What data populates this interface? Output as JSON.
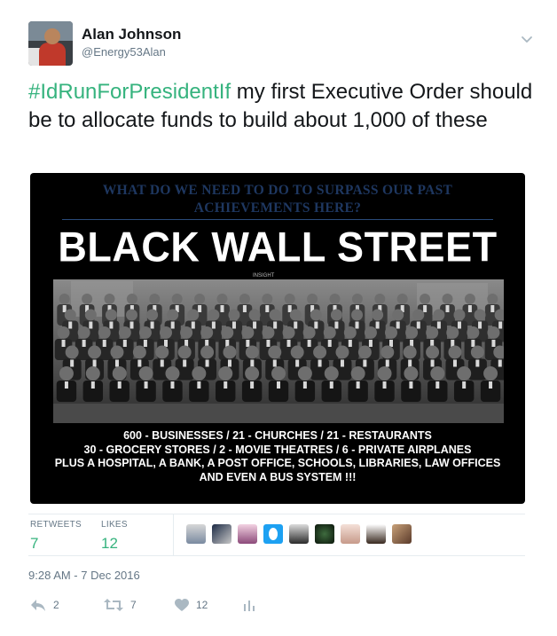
{
  "author": {
    "name": "Alan Johnson",
    "handle": "@Energy53Alan"
  },
  "tweet": {
    "hashtag": "#IdRunForPresidentIf",
    "text": " my first Executive Order should be to allocate funds to build about 1,000 of these"
  },
  "media": {
    "question_line1": "WHAT DO WE NEED TO DO TO SURPASS OUR PAST",
    "question_line2": "ACHIEVEMENTS HERE?",
    "headline": "BLACK WALL STREET",
    "fine_print": "INSIGHT",
    "facts_line1": "600 - BUSINESSES / 21 - CHURCHES / 21 - RESTAURANTS",
    "facts_line2": "30 - GROCERY STORES / 2 - MOVIE THEATRES / 6 - PRIVATE AIRPLANES",
    "facts_line3": "PLUS A HOSPITAL, A BANK, A POST OFFICE, SCHOOLS, LIBRARIES, LAW OFFICES",
    "facts_line4": "AND EVEN A BUS SYSTEM !!!"
  },
  "stats": {
    "retweets_label": "RETWEETS",
    "retweets_value": "7",
    "likes_label": "LIKES",
    "likes_value": "12"
  },
  "timestamp": "9:28 AM - 7 Dec 2016",
  "actions": {
    "reply_count": "2",
    "retweet_count": "7",
    "like_count": "12"
  },
  "colors": {
    "hashtag": "#36b37e",
    "stat_value": "#36b37e",
    "muted": "#657786",
    "icon": "#aab8c2"
  },
  "icons": [
    "caret-down-icon",
    "reply-icon",
    "retweet-icon",
    "heart-icon",
    "analytics-icon"
  ]
}
